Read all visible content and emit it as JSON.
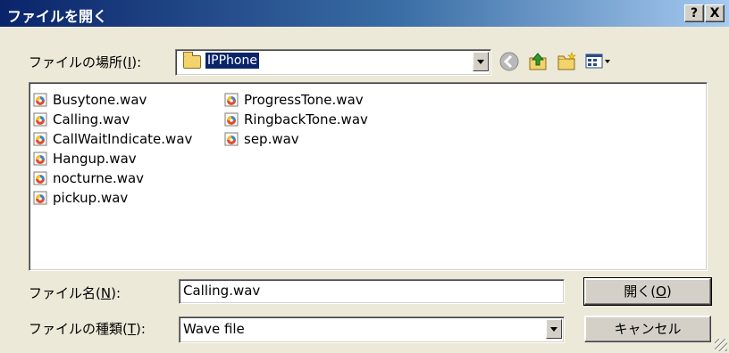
{
  "window": {
    "title": "ファイルを開く",
    "help_label": "?",
    "close_label": "X"
  },
  "location": {
    "label_prefix": "ファイルの場所(",
    "label_key": "I",
    "label_suffix": "):",
    "folder": "IPPhone"
  },
  "toolbar": {
    "icons": [
      "back-icon",
      "up-folder-icon",
      "new-folder-icon",
      "view-menu-icon"
    ]
  },
  "files": {
    "col1": [
      "Busytone.wav",
      "Calling.wav",
      "CallWaitIndicate.wav",
      "Hangup.wav",
      "nocturne.wav",
      "pickup.wav"
    ],
    "col2": [
      "ProgressTone.wav",
      "RingbackTone.wav",
      "sep.wav"
    ]
  },
  "filename": {
    "label_prefix": "ファイル名(",
    "label_key": "N",
    "label_suffix": "):",
    "value": "Calling.wav"
  },
  "filetype": {
    "label_prefix": "ファイルの種類(",
    "label_key": "T",
    "label_suffix": "):",
    "value": "Wave file"
  },
  "buttons": {
    "open_prefix": "開く(",
    "open_key": "O",
    "open_suffix": ")",
    "cancel": "キャンセル"
  },
  "colors": {
    "titlebar_start": "#0a246a",
    "titlebar_end": "#a6caf0",
    "dialog_bg": "#ece9d8",
    "selection": "#0a246a"
  }
}
